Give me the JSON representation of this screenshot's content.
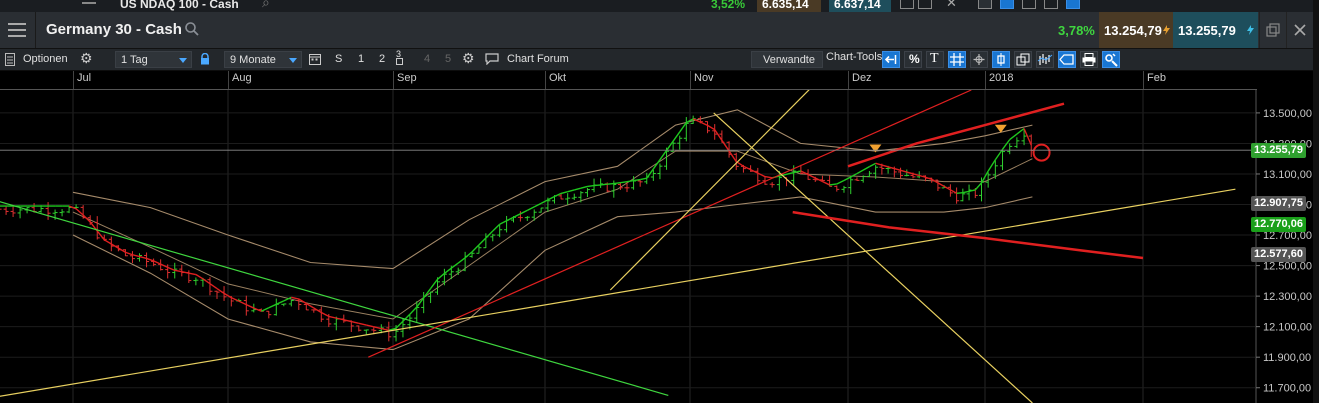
{
  "back_window": {
    "title": "US NDAQ 100 - Cash",
    "pct_change": "3,52%",
    "bid": "6.635,14",
    "ask": "6.637,14"
  },
  "window": {
    "title": "Germany 30 - Cash",
    "pct_change": "3,78%",
    "bid": "13.254,79",
    "ask": "13.255,79"
  },
  "toolbar": {
    "options_label": "Optionen",
    "interval_value": "1 Tag",
    "range_value": "9 Monate",
    "mode_s": "S",
    "layout_1": "1",
    "layout_2": "2",
    "layout_3": "3",
    "layout_4": "4",
    "layout_5": "5",
    "forum_label": "Chart Forum",
    "related_label": "Verwandte",
    "charttools_label": "Chart-Tools",
    "percent_label": "%",
    "text_tool_label": "T"
  },
  "colors": {
    "titlebar_bg": "#2a2e33",
    "bid_bg": "#4a3a25",
    "ask_bg": "#1e4e5c",
    "positive": "#3fd63f",
    "tool_active": "#1976d2",
    "price_current": "#2fa02f",
    "price_upper": "#555555",
    "price_middle": "#1aa01a",
    "price_lower": "#555555"
  },
  "chart_data": {
    "type": "candlestick",
    "months": [
      "Jul",
      "Aug",
      "Sep",
      "Okt",
      "Nov",
      "Dez",
      "2018",
      "Feb"
    ],
    "yticks": [
      13500,
      13300,
      13100,
      12900,
      12700,
      12500,
      12300,
      12100,
      11900,
      11700
    ],
    "ytick_labels": [
      "13.500,00",
      "13.300,00",
      "13.100,00",
      "12.900,00",
      "12.700,00",
      "12.500,00",
      "12.300,00",
      "12.100,00",
      "11.900,00",
      "11.700,00"
    ],
    "ylim": [
      11600,
      13650
    ],
    "price_tags": [
      {
        "label": "13.255,79",
        "value": 13255.79,
        "kind": "current"
      },
      {
        "label": "12.907,75",
        "value": 12907.75,
        "kind": "upper"
      },
      {
        "label": "12.770,06",
        "value": 12770.06,
        "kind": "middle"
      },
      {
        "label": "12.577,60",
        "value": 12577.6,
        "kind": "lower"
      }
    ],
    "close_path": [
      {
        "m": 0.0,
        "v": 12870
      },
      {
        "m": 0.1,
        "v": 12780
      },
      {
        "m": 0.2,
        "v": 12650
      },
      {
        "m": 0.35,
        "v": 12560
      },
      {
        "m": 0.5,
        "v": 12520
      },
      {
        "m": 0.65,
        "v": 12450
      },
      {
        "m": 0.8,
        "v": 12420
      },
      {
        "m": 1.0,
        "v": 12280
      },
      {
        "m": 1.2,
        "v": 12180
      },
      {
        "m": 1.4,
        "v": 12280
      },
      {
        "m": 1.6,
        "v": 12150
      },
      {
        "m": 1.8,
        "v": 12100
      },
      {
        "m": 2.0,
        "v": 12050
      },
      {
        "m": 2.15,
        "v": 12200
      },
      {
        "m": 2.3,
        "v": 12400
      },
      {
        "m": 2.5,
        "v": 12550
      },
      {
        "m": 2.7,
        "v": 12750
      },
      {
        "m": 2.9,
        "v": 12850
      },
      {
        "m": 3.1,
        "v": 12950
      },
      {
        "m": 3.3,
        "v": 13000
      },
      {
        "m": 3.5,
        "v": 13020
      },
      {
        "m": 3.7,
        "v": 13050
      },
      {
        "m": 3.85,
        "v": 13250
      },
      {
        "m": 4.0,
        "v": 13450
      },
      {
        "m": 4.15,
        "v": 13380
      },
      {
        "m": 4.3,
        "v": 13150
      },
      {
        "m": 4.5,
        "v": 13050
      },
      {
        "m": 4.7,
        "v": 13100
      },
      {
        "m": 4.9,
        "v": 13000
      },
      {
        "m": 5.0,
        "v": 13050
      },
      {
        "m": 5.2,
        "v": 13150
      },
      {
        "m": 5.4,
        "v": 13100
      },
      {
        "m": 5.6,
        "v": 13050
      },
      {
        "m": 5.8,
        "v": 12950
      },
      {
        "m": 5.95,
        "v": 12980
      },
      {
        "m": 6.05,
        "v": 13150
      },
      {
        "m": 6.15,
        "v": 13300
      },
      {
        "m": 6.25,
        "v": 13380
      },
      {
        "m": 6.3,
        "v": 13250
      }
    ],
    "bollinger_upper": [
      {
        "m": 0.0,
        "v": 12980
      },
      {
        "m": 0.5,
        "v": 12880
      },
      {
        "m": 1.0,
        "v": 12700
      },
      {
        "m": 1.5,
        "v": 12520
      },
      {
        "m": 2.0,
        "v": 12480
      },
      {
        "m": 2.5,
        "v": 12800
      },
      {
        "m": 3.0,
        "v": 13050
      },
      {
        "m": 3.5,
        "v": 13150
      },
      {
        "m": 3.9,
        "v": 13420
      },
      {
        "m": 4.3,
        "v": 13520
      },
      {
        "m": 4.7,
        "v": 13300
      },
      {
        "m": 5.2,
        "v": 13250
      },
      {
        "m": 5.7,
        "v": 13300
      },
      {
        "m": 6.0,
        "v": 13350
      },
      {
        "m": 6.3,
        "v": 13420
      }
    ],
    "bollinger_lower": [
      {
        "m": 0.0,
        "v": 12700
      },
      {
        "m": 0.5,
        "v": 12450
      },
      {
        "m": 1.0,
        "v": 12150
      },
      {
        "m": 1.5,
        "v": 12000
      },
      {
        "m": 2.0,
        "v": 11950
      },
      {
        "m": 2.5,
        "v": 12150
      },
      {
        "m": 3.0,
        "v": 12600
      },
      {
        "m": 3.5,
        "v": 12820
      },
      {
        "m": 3.9,
        "v": 12850
      },
      {
        "m": 4.3,
        "v": 12900
      },
      {
        "m": 4.7,
        "v": 12950
      },
      {
        "m": 5.2,
        "v": 12850
      },
      {
        "m": 5.7,
        "v": 12850
      },
      {
        "m": 6.0,
        "v": 12880
      },
      {
        "m": 6.3,
        "v": 12950
      }
    ],
    "moving_average": [
      {
        "m": 0.0,
        "v": 12850
      },
      {
        "m": 0.5,
        "v": 12620
      },
      {
        "m": 1.0,
        "v": 12380
      },
      {
        "m": 1.5,
        "v": 12250
      },
      {
        "m": 2.0,
        "v": 12150
      },
      {
        "m": 2.5,
        "v": 12500
      },
      {
        "m": 3.0,
        "v": 12850
      },
      {
        "m": 3.5,
        "v": 13000
      },
      {
        "m": 3.9,
        "v": 13250
      },
      {
        "m": 4.3,
        "v": 13250
      },
      {
        "m": 4.7,
        "v": 13100
      },
      {
        "m": 5.2,
        "v": 13080
      },
      {
        "m": 5.7,
        "v": 13050
      },
      {
        "m": 6.0,
        "v": 13050
      },
      {
        "m": 6.3,
        "v": 13200
      }
    ],
    "trend_lines": [
      {
        "color": "#3fd63f",
        "points": [
          {
            "m": -0.55,
            "v": 12940
          },
          {
            "m": 3.85,
            "v": 11650
          }
        ]
      },
      {
        "color": "#e02020",
        "points": [
          {
            "m": 1.85,
            "v": 11900
          },
          {
            "m": 5.9,
            "v": 13650
          }
        ]
      },
      {
        "color": "#e8d060",
        "points": [
          {
            "m": -0.5,
            "v": 11640
          },
          {
            "m": 7.6,
            "v": 13000
          }
        ]
      },
      {
        "color": "#e8d060",
        "points": [
          {
            "m": 3.45,
            "v": 12340
          },
          {
            "m": 4.8,
            "v": 13700
          }
        ]
      },
      {
        "color": "#e8d060",
        "points": [
          {
            "m": 4.15,
            "v": 13500
          },
          {
            "m": 6.3,
            "v": 11600
          }
        ]
      },
      {
        "color": "#e02020",
        "width": 2.5,
        "points": [
          {
            "m": 5.0,
            "v": 13150
          },
          {
            "m": 5.5,
            "v": 13300
          },
          {
            "m": 6.0,
            "v": 13420
          },
          {
            "m": 6.5,
            "v": 13560
          }
        ]
      },
      {
        "color": "#e02020",
        "width": 2.5,
        "points": [
          {
            "m": 4.65,
            "v": 12850
          },
          {
            "m": 5.3,
            "v": 12750
          },
          {
            "m": 6.0,
            "v": 12680
          },
          {
            "m": 6.6,
            "v": 12600
          },
          {
            "m": 7.0,
            "v": 12550
          }
        ]
      }
    ],
    "markers": [
      {
        "m": 5.2,
        "v": 13260,
        "kind": "triangle"
      },
      {
        "m": 6.1,
        "v": 13390,
        "kind": "triangle"
      },
      {
        "m": 6.32,
        "v": 13240,
        "kind": "circle"
      }
    ]
  }
}
